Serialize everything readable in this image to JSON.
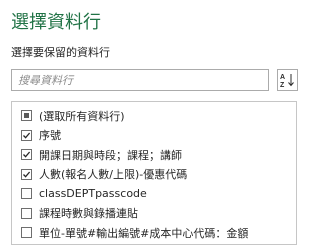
{
  "panel": {
    "title": "選擇資料行",
    "subtitle": "選擇要保留的資料行",
    "search": {
      "placeholder": "搜尋資料行",
      "value": ""
    },
    "sort_icon": "sort-az-icon",
    "columns": [
      {
        "label": "(選取所有資料行)",
        "state": "partial"
      },
      {
        "label": "序號",
        "state": "checked"
      },
      {
        "label": "開課日期與時段；課程；講師",
        "state": "checked"
      },
      {
        "label": "人數(報名人數/上限)-優惠代碼",
        "state": "checked"
      },
      {
        "label": "classDEPTpasscode",
        "state": "unchecked"
      },
      {
        "label": "課程時數與錄播連貼",
        "state": "unchecked"
      },
      {
        "label": "單位-單號#輸出編號#成本中心代碼：金額",
        "state": "unchecked"
      }
    ]
  },
  "colors": {
    "accent": "#217346",
    "text": "#262626",
    "border": "#ababab"
  }
}
